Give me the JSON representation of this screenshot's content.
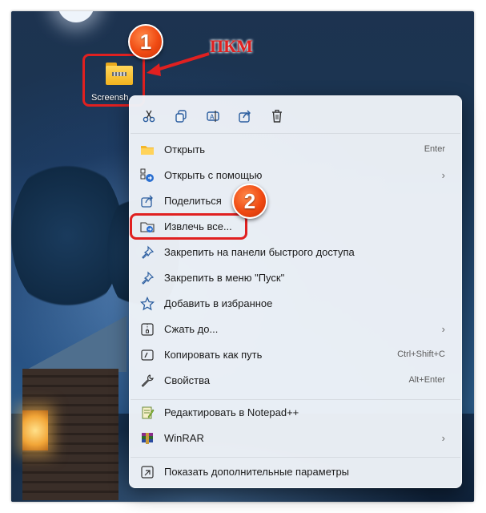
{
  "desktop": {
    "icon_label": "Screensh"
  },
  "annotations": {
    "step1": "1",
    "step2": "2",
    "action_text": "ПКМ",
    "accent_color": "#e02020"
  },
  "context_menu": {
    "quick_actions": [
      {
        "name": "cut",
        "icon": "scissors-icon"
      },
      {
        "name": "copy",
        "icon": "copy-icon"
      },
      {
        "name": "rename",
        "icon": "rename-icon"
      },
      {
        "name": "share",
        "icon": "share-icon"
      },
      {
        "name": "delete",
        "icon": "trash-icon"
      }
    ],
    "items": [
      {
        "label": "Открыть",
        "shortcut": "Enter",
        "icon": "folder-icon"
      },
      {
        "label": "Открыть с помощью",
        "submenu": true,
        "icon": "open-with-icon"
      },
      {
        "label": "Поделиться",
        "icon": "share-icon"
      },
      {
        "label": "Извлечь все...",
        "icon": "extract-icon"
      },
      {
        "label": "Закрепить на панели быстрого доступа",
        "icon": "pin-icon"
      },
      {
        "label": "Закрепить в меню \"Пуск\"",
        "icon": "pin-icon"
      },
      {
        "label": "Добавить в избранное",
        "icon": "star-icon"
      },
      {
        "label": "Сжать до...",
        "submenu": true,
        "icon": "compress-icon"
      },
      {
        "label": "Копировать как путь",
        "shortcut": "Ctrl+Shift+C",
        "icon": "copy-path-icon"
      },
      {
        "label": "Свойства",
        "shortcut": "Alt+Enter",
        "icon": "wrench-icon"
      },
      {
        "label": "Редактировать в Notepad++",
        "icon": "notepad-icon"
      },
      {
        "label": "WinRAR",
        "submenu": true,
        "icon": "winrar-icon"
      },
      {
        "label": "Показать дополнительные параметры",
        "icon": "more-options-icon"
      }
    ]
  }
}
